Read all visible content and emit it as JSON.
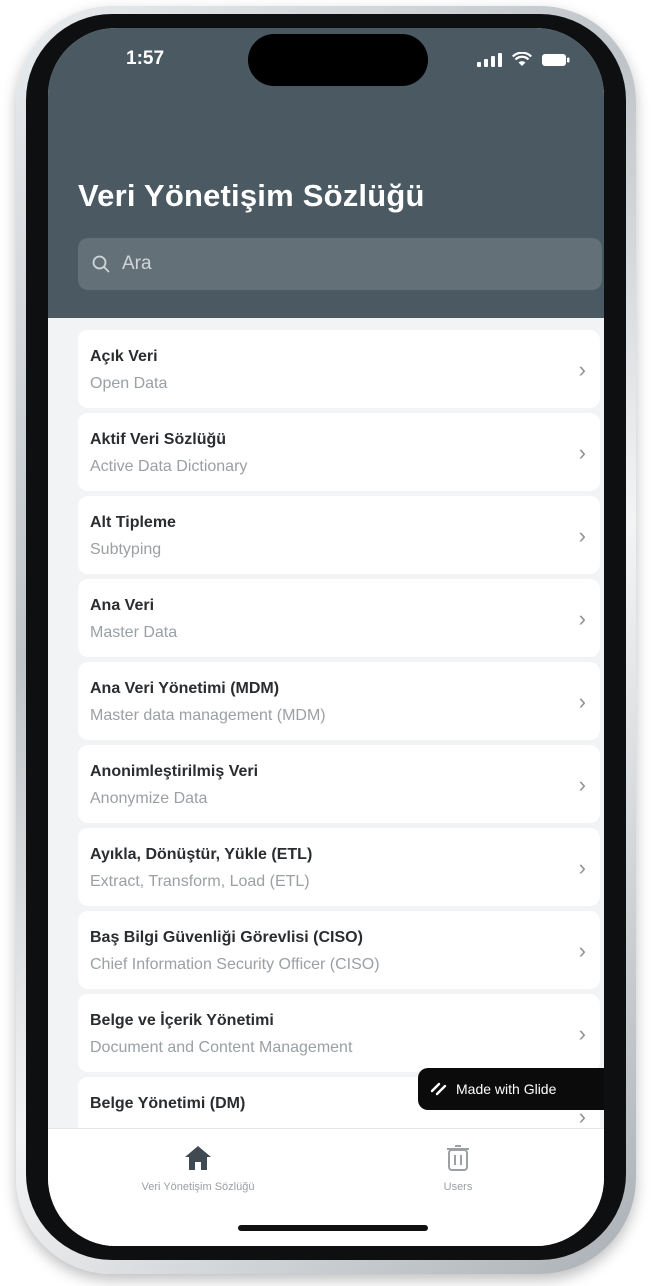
{
  "status_bar": {
    "time": "1:57"
  },
  "header": {
    "title": "Veri Yönetişim Sözlüğü",
    "search_placeholder": "Ara"
  },
  "items": [
    {
      "title": "Açık Veri",
      "subtitle": "Open Data"
    },
    {
      "title": "Aktif Veri Sözlüğü",
      "subtitle": "Active Data Dictionary"
    },
    {
      "title": "Alt Tipleme",
      "subtitle": "Subtyping"
    },
    {
      "title": "Ana Veri",
      "subtitle": "Master Data"
    },
    {
      "title": "Ana Veri Yönetimi (MDM)",
      "subtitle": "Master data management (MDM)"
    },
    {
      "title": "Anonimleştirilmiş Veri",
      "subtitle": "Anonymize Data"
    },
    {
      "title": "Ayıkla, Dönüştür, Yükle (ETL)",
      "subtitle": "Extract, Transform, Load (ETL)"
    },
    {
      "title": "Baş Bilgi Güvenliği Görevlisi (CISO)",
      "subtitle": "Chief Information Security Officer (CISO)"
    },
    {
      "title": "Belge ve İçerik Yönetimi",
      "subtitle": "Document and Content Management"
    },
    {
      "title": "Belge Yönetimi (DM)",
      "subtitle": ""
    }
  ],
  "glide_badge": "Made with Glide",
  "tabs": [
    {
      "label": "Veri Yönetişim Sözlüğü",
      "icon": "home-icon"
    },
    {
      "label": "Users",
      "icon": "trash-icon"
    }
  ],
  "colors": {
    "header_bg": "#4a5962",
    "accent": "#4a5962"
  }
}
